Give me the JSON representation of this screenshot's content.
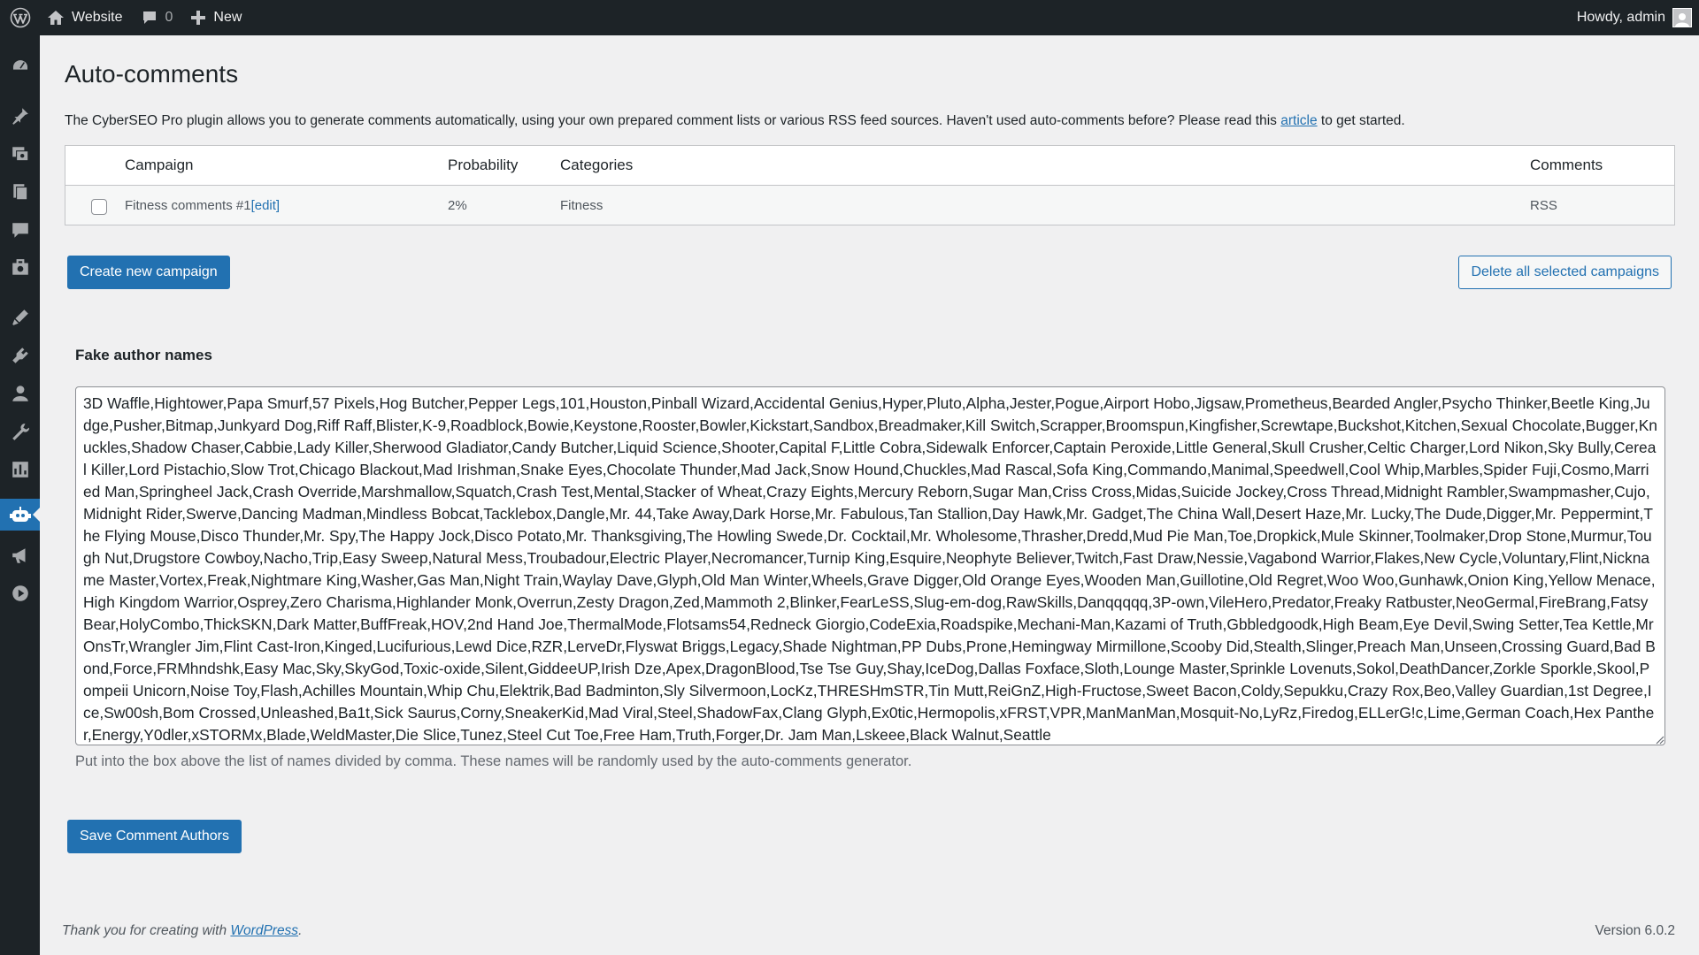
{
  "adminbar": {
    "site_name": "Website",
    "comments_count": "0",
    "new_label": "New",
    "howdy": "Howdy, admin"
  },
  "sidebar": {
    "icons": [
      "dashboard-icon",
      "posts-icon",
      "media-icon",
      "pages-icon",
      "comments-icon",
      "portfolio-icon",
      "appearance-icon",
      "plugins-icon",
      "users-icon",
      "tools-icon",
      "settings-icon",
      "cyberseo-icon",
      "marketing-icon",
      "video-icon"
    ],
    "active": "cyberseo-icon"
  },
  "page": {
    "title": "Auto-comments",
    "intro_text": "The CyberSEO Pro plugin allows you to generate comments automatically, using your own prepared comment lists or various RSS feed sources. Haven't used auto-comments before? Please read this",
    "intro_link": "article",
    "intro_suffix": " to get started."
  },
  "table": {
    "headers": {
      "campaign": "Campaign",
      "probability": "Probability",
      "categories": "Categories",
      "comments": "Comments"
    },
    "rows": [
      {
        "campaign": "Fitness comments #1",
        "edit": "[edit]",
        "probability": "2%",
        "categories": "Fitness",
        "comments": "RSS"
      }
    ]
  },
  "buttons": {
    "create": "Create new campaign",
    "delete_selected": "Delete all selected campaigns",
    "save_authors": "Save Comment Authors"
  },
  "authors": {
    "title": "Fake author names",
    "names": "3D Waffle,Hightower,Papa Smurf,57 Pixels,Hog Butcher,Pepper Legs,101,Houston,Pinball Wizard,Accidental Genius,Hyper,Pluto,Alpha,Jester,Pogue,Airport Hobo,Jigsaw,Prometheus,Bearded Angler,Psycho Thinker,Beetle King,Judge,Pusher,Bitmap,Junkyard Dog,Riff Raff,Blister,K-9,Roadblock,Bowie,Keystone,Rooster,Bowler,Kickstart,Sandbox,Breadmaker,Kill Switch,Scrapper,Broomspun,Kingfisher,Screwtape,Buckshot,Kitchen,Sexual Chocolate,Bugger,Knuckles,Shadow Chaser,Cabbie,Lady Killer,Sherwood Gladiator,Candy Butcher,Liquid Science,Shooter,Capital F,Little Cobra,Sidewalk Enforcer,Captain Peroxide,Little General,Skull Crusher,Celtic Charger,Lord Nikon,Sky Bully,Cereal Killer,Lord Pistachio,Slow Trot,Chicago Blackout,Mad Irishman,Snake Eyes,Chocolate Thunder,Mad Jack,Snow Hound,Chuckles,Mad Rascal,Sofa King,Commando,Manimal,Speedwell,Cool Whip,Marbles,Spider Fuji,Cosmo,Married Man,Springheel Jack,Crash Override,Marshmallow,Squatch,Crash Test,Mental,Stacker of Wheat,Crazy Eights,Mercury Reborn,Sugar Man,Criss Cross,Midas,Suicide Jockey,Cross Thread,Midnight Rambler,Swampmasher,Cujo,Midnight Rider,Swerve,Dancing Madman,Mindless Bobcat,Tacklebox,Dangle,Mr. 44,Take Away,Dark Horse,Mr. Fabulous,Tan Stallion,Day Hawk,Mr. Gadget,The China Wall,Desert Haze,Mr. Lucky,The Dude,Digger,Mr. Peppermint,The Flying Mouse,Disco Thunder,Mr. Spy,The Happy Jock,Disco Potato,Mr. Thanksgiving,The Howling Swede,Dr. Cocktail,Mr. Wholesome,Thrasher,Dredd,Mud Pie Man,Toe,Dropkick,Mule Skinner,Toolmaker,Drop Stone,Murmur,Tough Nut,Drugstore Cowboy,Nacho,Trip,Easy Sweep,Natural Mess,Troubadour,Electric Player,Necromancer,Turnip King,Esquire,Neophyte Believer,Twitch,Fast Draw,Nessie,Vagabond Warrior,Flakes,New Cycle,Voluntary,Flint,Nickname Master,Vortex,Freak,Nightmare King,Washer,Gas Man,Night Train,Waylay Dave,Glyph,Old Man Winter,Wheels,Grave Digger,Old Orange Eyes,Wooden Man,Guillotine,Old Regret,Woo Woo,Gunhawk,Onion King,Yellow Menace,High Kingdom Warrior,Osprey,Zero Charisma,Highlander Monk,Overrun,Zesty Dragon,Zed,Mammoth 2,Blinker,FearLeSS,Slug-em-dog,RawSkills,Danqqqqq,3P-own,VileHero,Predator,Freaky Ratbuster,NeoGermal,FireBrang,Fatsy Bear,HolyCombo,ThickSKN,Dark Matter,BuffFreak,HOV,2nd Hand Joe,ThermalMode,Flotsams54,Redneck Giorgio,CodeExia,Roadspike,Mechani-Man,Kazami of Truth,Gbbledgoodk,High Beam,Eye Devil,Swing Setter,Tea Kettle,MrOnsTr,Wrangler Jim,Flint Cast-Iron,Kinged,Lucifurious,Lewd Dice,RZR,LerveDr,Flyswat Briggs,Legacy,Shade Nightman,PP Dubs,Prone,Hemingway Mirmillone,Scooby Did,Stealth,Slinger,Preach Man,Unseen,Crossing Guard,Bad Bond,Force,FRMhndshk,Easy Mac,Sky,SkyGod,Toxic-oxide,Silent,GiddeeUP,Irish Dze,Apex,DragonBlood,Tse Tse Guy,Shay,IceDog,Dallas Foxface,Sloth,Lounge Master,Sprinkle Lovenuts,Sokol,DeathDancer,Zorkle Sporkle,Skool,Pompeii Unicorn,Noise Toy,Flash,Achilles Mountain,Whip Chu,Elektrik,Bad Badminton,Sly Silvermoon,LocKz,THRESHmSTR,Tin Mutt,ReiGnZ,High-Fructose,Sweet Bacon,Coldy,Sepukku,Crazy Rox,Beo,Valley Guardian,1st Degree,Ice,Sw00sh,Bom Crossed,Unleashed,Ba1t,Sick Saurus,Corny,SneakerKid,Mad Viral,Steel,ShadowFax,Clang Glyph,Ex0tic,Hermopolis,xFRST,VPR,ManManMan,Mosquit-No,LyRz,Firedog,ELLerG!c,Lime,German Coach,Hex Panther,Energy,Y0dler,xSTORMx,Blade,WeldMaster,Die Slice,Tunez,Steel Cut Toe,Free Ham,Truth,Forger,Dr. Jam Man,Lskeee,Black Walnut,Seattle",
    "help": "Put into the box above the list of names divided by comma. These names will be randomly used by the auto-comments generator."
  },
  "footer": {
    "thanks_prefix": "Thank you for creating with ",
    "thanks_link": "WordPress",
    "thanks_suffix": ".",
    "version": "Version 6.0.2"
  },
  "colors": {
    "accent": "#2271b1",
    "adminbar": "#1d2327",
    "background": "#f0f0f1"
  }
}
